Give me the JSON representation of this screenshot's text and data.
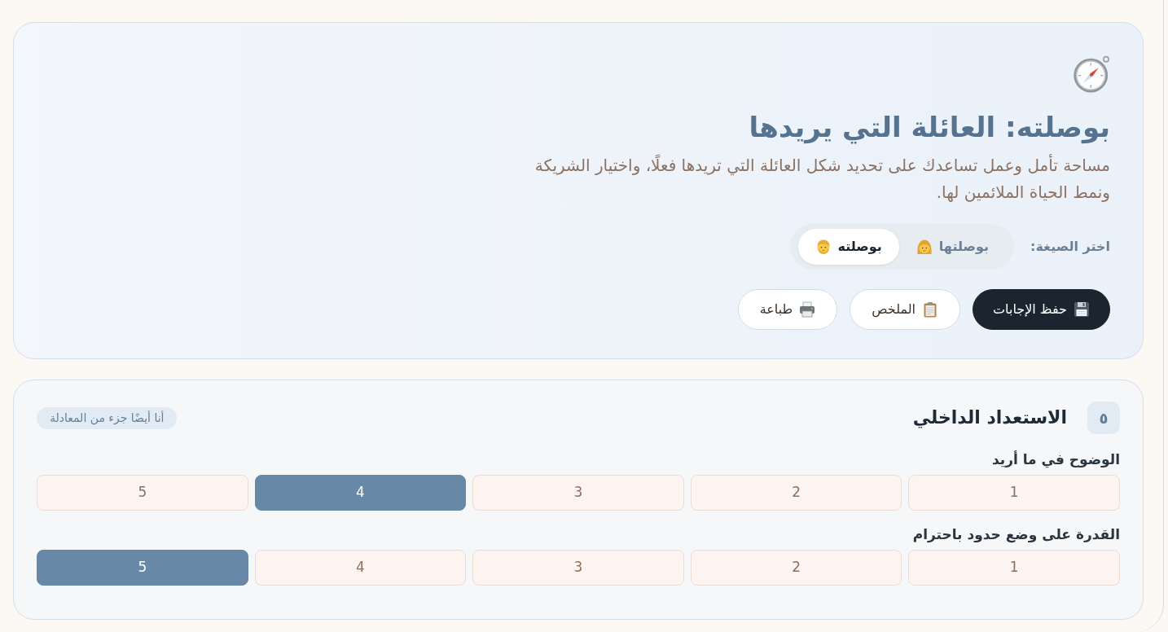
{
  "header": {
    "title": "بوصلته: العائلة التي يريدها",
    "description": "مساحة تأمل وعمل تساعدك على تحديد شكل العائلة التي تريدها فعلًا، واختيار الشريكة ونمط الحياة الملائمين لها.",
    "format_label": "اختر الصيغة:",
    "format_options": [
      {
        "label": "بوصلتها",
        "selected": false
      },
      {
        "label": "بوصلته",
        "selected": true
      }
    ],
    "actions": [
      {
        "label": "حفظ الإجابات",
        "kind": "primary"
      },
      {
        "label": "الملخص",
        "kind": "secondary"
      },
      {
        "label": "طباعة",
        "kind": "secondary"
      }
    ]
  },
  "section": {
    "number": "٥",
    "title": "الاستعداد الداخلي",
    "tag": "أنا أيضًا جزء من المعادلة",
    "questions": [
      {
        "label": "الوضوح في ما أريد",
        "options": [
          {
            "label": "1",
            "selected": false
          },
          {
            "label": "2",
            "selected": false
          },
          {
            "label": "3",
            "selected": false
          },
          {
            "label": "4",
            "selected": true
          },
          {
            "label": "5",
            "selected": false
          }
        ]
      },
      {
        "label": "القدرة على وضع حدود باحترام",
        "options": [
          {
            "label": "1",
            "selected": false
          },
          {
            "label": "2",
            "selected": false
          },
          {
            "label": "3",
            "selected": false
          },
          {
            "label": "4",
            "selected": false
          },
          {
            "label": "5",
            "selected": true
          }
        ]
      }
    ]
  }
}
